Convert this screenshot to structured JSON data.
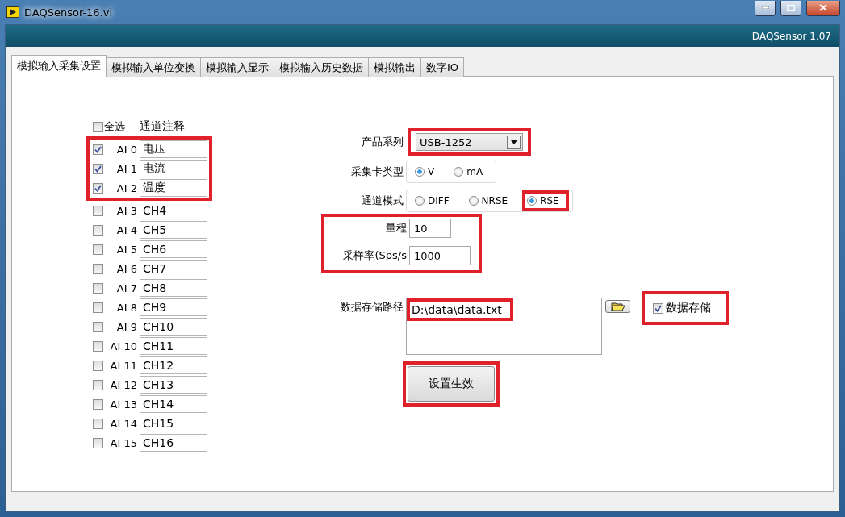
{
  "window": {
    "title": "DAQSensor-16.vi"
  },
  "header": {
    "version": "DAQSensor 1.07"
  },
  "tabs": [
    {
      "label": "模拟输入采集设置",
      "selected": true
    },
    {
      "label": "模拟输入单位变换",
      "selected": false
    },
    {
      "label": "模拟输入显示",
      "selected": false
    },
    {
      "label": "模拟输入历史数据",
      "selected": false
    },
    {
      "label": "模拟输出",
      "selected": false
    },
    {
      "label": "数字IO",
      "selected": false
    }
  ],
  "channel_list": {
    "select_all": {
      "label": "全选",
      "checked": false
    },
    "note_heading": "通道注释",
    "channels": [
      {
        "name": "AI 0",
        "checked": true,
        "note": "电压",
        "highlighted": true
      },
      {
        "name": "AI 1",
        "checked": true,
        "note": "电流",
        "highlighted": true
      },
      {
        "name": "AI 2",
        "checked": true,
        "note": "温度",
        "highlighted": true
      },
      {
        "name": "AI 3",
        "checked": false,
        "note": "CH4",
        "highlighted": false
      },
      {
        "name": "AI 4",
        "checked": false,
        "note": "CH5",
        "highlighted": false
      },
      {
        "name": "AI 5",
        "checked": false,
        "note": "CH6",
        "highlighted": false
      },
      {
        "name": "AI 6",
        "checked": false,
        "note": "CH7",
        "highlighted": false
      },
      {
        "name": "AI 7",
        "checked": false,
        "note": "CH8",
        "highlighted": false
      },
      {
        "name": "AI 8",
        "checked": false,
        "note": "CH9",
        "highlighted": false
      },
      {
        "name": "AI 9",
        "checked": false,
        "note": "CH10",
        "highlighted": false
      },
      {
        "name": "AI 10",
        "checked": false,
        "note": "CH11",
        "highlighted": false
      },
      {
        "name": "AI 11",
        "checked": false,
        "note": "CH12",
        "highlighted": false
      },
      {
        "name": "AI 12",
        "checked": false,
        "note": "CH13",
        "highlighted": false
      },
      {
        "name": "AI 13",
        "checked": false,
        "note": "CH14",
        "highlighted": false
      },
      {
        "name": "AI 14",
        "checked": false,
        "note": "CH15",
        "highlighted": false
      },
      {
        "name": "AI 15",
        "checked": false,
        "note": "CH16",
        "highlighted": false
      }
    ]
  },
  "settings": {
    "product": {
      "label": "产品系列",
      "value": "USB-1252",
      "highlighted": true
    },
    "card_type": {
      "label": "采集卡类型",
      "options": [
        {
          "label": "V",
          "selected": true,
          "highlighted": false
        },
        {
          "label": "mA",
          "selected": false,
          "highlighted": false
        }
      ]
    },
    "channel_mode": {
      "label": "通道模式",
      "options": [
        {
          "label": "DIFF",
          "selected": false,
          "highlighted": false
        },
        {
          "label": "NRSE",
          "selected": false,
          "highlighted": false
        },
        {
          "label": "RSE",
          "selected": true,
          "highlighted": true
        }
      ]
    },
    "range": {
      "label": "量程",
      "value": "10",
      "highlighted": true
    },
    "sample_rate": {
      "label": "采样率(Sps/s",
      "value": "1000",
      "highlighted": true
    },
    "storage_path": {
      "label": "数据存储路径",
      "value": "D:\\data\\data.txt",
      "highlighted": true
    },
    "save_data": {
      "label": "数据存储",
      "checked": true,
      "highlighted": true
    },
    "apply_button": {
      "label": "设置生效",
      "highlighted": true
    }
  }
}
